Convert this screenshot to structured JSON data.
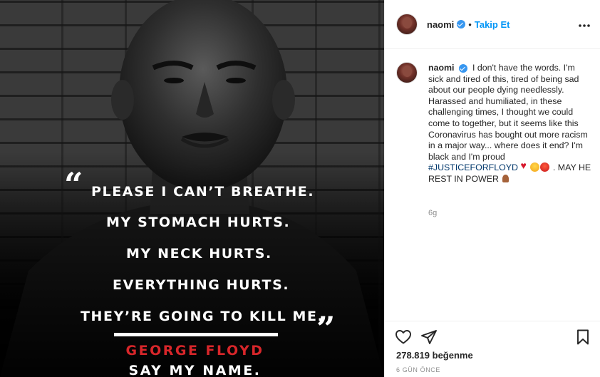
{
  "post_image": {
    "quote_lines": [
      "PLEASE I CAN’T BREATHE.",
      "MY STOMACH HURTS.",
      "MY NECK HURTS.",
      "EVERYTHING HURTS.",
      "THEY’RE GOING TO KILL ME."
    ],
    "open_quote": "“",
    "close_quote": "”",
    "name": "GEORGE FLOYD",
    "tagline": "SAY MY NAME.",
    "name_color": "#d8262a"
  },
  "header": {
    "username": "naomi",
    "separator": "•",
    "follow_label": "Takip Et",
    "more_icon": "more-options-icon",
    "more_label": "•••"
  },
  "caption": {
    "username": "naomi",
    "text": "I don't have the words. I'm sick and tired of this, tired of being sad about our people dying needlessly. Harassed and humiliated, in these challenging times, I thought we could come to together, but it seems like this Coronavirus has bought out more racism in a major way... where does it end? I'm black and I'm proud ",
    "hashtag": "#JUSTICEFORFLOYD",
    "after_emoji": ". MAY HE REST IN POWER",
    "emojis": [
      "red-heart",
      "sad-face",
      "angry-face",
      "praying-hands"
    ],
    "time_ago": "6g"
  },
  "actions": {
    "like_icon": "heart-icon",
    "share_icon": "send-icon",
    "save_icon": "bookmark-icon",
    "likes_count": "278.819",
    "likes_label": "beğenme",
    "date": "6 GÜN ÖNCE"
  },
  "colors": {
    "link": "#0095f6",
    "verified": "#3897f0",
    "hashtag": "#00376b",
    "muted": "#8e8e8e"
  }
}
